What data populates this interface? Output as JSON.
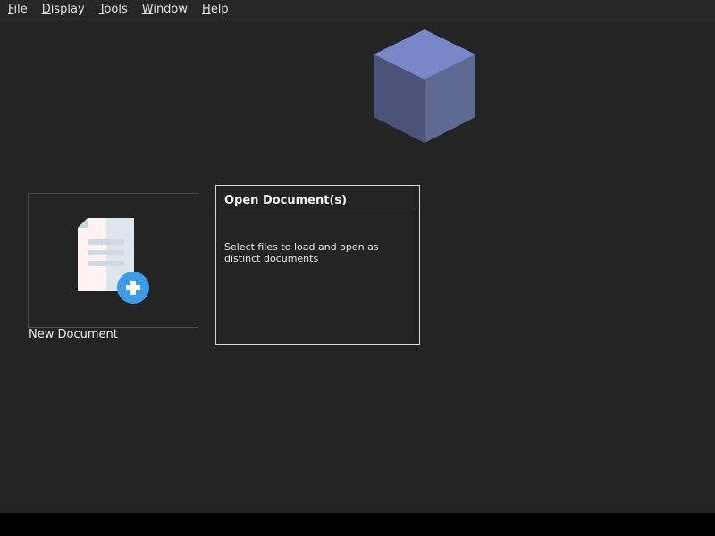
{
  "menubar": {
    "items": [
      {
        "mnemonic": "F",
        "rest": "ile"
      },
      {
        "mnemonic": "D",
        "rest": "isplay"
      },
      {
        "mnemonic": "T",
        "rest": "ools"
      },
      {
        "mnemonic": "W",
        "rest": "indow"
      },
      {
        "mnemonic": "H",
        "rest": "elp"
      }
    ]
  },
  "welcome": {
    "new_document": {
      "label": "New Document"
    },
    "open_documents": {
      "title": "Open Document(s)",
      "description": "Select files to load and open as distinct documents"
    }
  },
  "colors": {
    "background": "#242424",
    "cube_top": "#7986c8",
    "cube_left": "#4a5378",
    "cube_right": "#5f6a93",
    "plus_badge": "#3d9be9"
  }
}
